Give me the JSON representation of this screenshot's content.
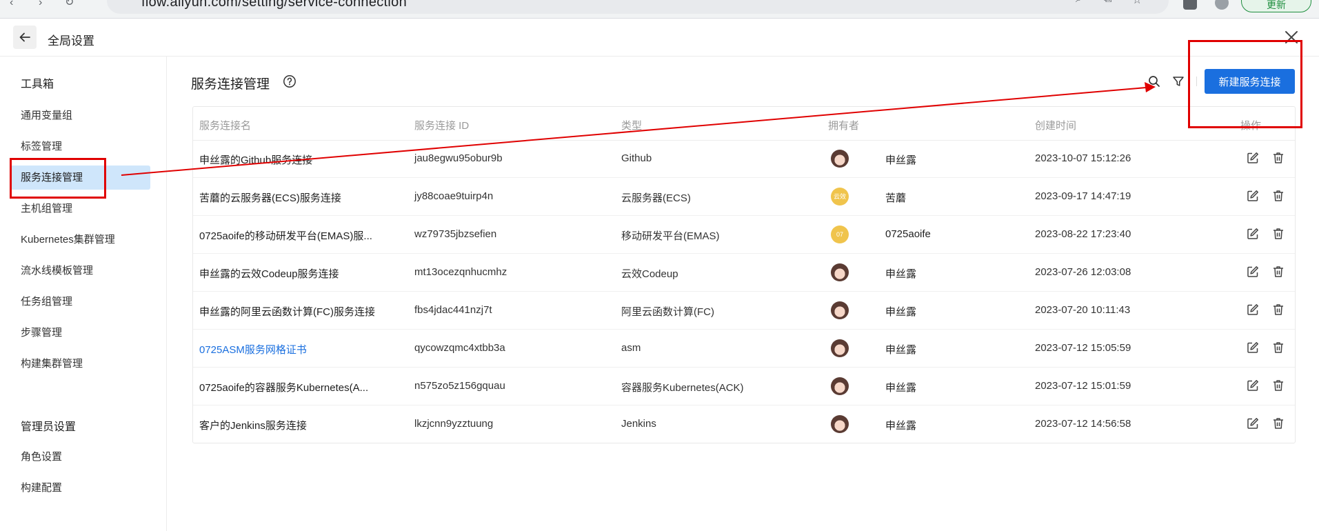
{
  "browser": {
    "url": "flow.aliyun.com/setting/service-connection",
    "update_label": "更新"
  },
  "header": {
    "title": "全局设置"
  },
  "sidebar": {
    "toolbox_title": "工具箱",
    "toolbox_items": [
      {
        "label": "通用变量组"
      },
      {
        "label": "标签管理"
      },
      {
        "label": "服务连接管理",
        "active": true
      },
      {
        "label": "主机组管理"
      },
      {
        "label": "Kubernetes集群管理"
      },
      {
        "label": "流水线模板管理"
      },
      {
        "label": "任务组管理"
      },
      {
        "label": "步骤管理"
      },
      {
        "label": "构建集群管理"
      }
    ],
    "admin_title": "管理员设置",
    "admin_items": [
      {
        "label": "角色设置"
      },
      {
        "label": "构建配置"
      }
    ]
  },
  "main": {
    "title": "服务连接管理",
    "new_button": "新建服务连接",
    "columns": [
      "服务连接名",
      "服务连接 ID",
      "类型",
      "拥有者",
      "创建时间",
      "操作"
    ],
    "rows": [
      {
        "name": "申丝露的Github服务连接",
        "id": "jau8egwu95obur9b",
        "type": "Github",
        "owner": "申丝露",
        "avatar": "photo",
        "created": "2023-10-07 15:12:26"
      },
      {
        "name": "苦蘑的云服务器(ECS)服务连接",
        "id": "jy88coae9tuirp4n",
        "type": "云服务器(ECS)",
        "owner": "苦蘑",
        "avatar": "gold",
        "avatar_text": "云效",
        "created": "2023-09-17 14:47:19"
      },
      {
        "name": "0725aoife的移动研发平台(EMAS)服...",
        "id": "wz79735jbzsefien",
        "type": "移动研发平台(EMAS)",
        "owner": "0725aoife",
        "avatar": "gold",
        "avatar_text": "07",
        "created": "2023-08-22 17:23:40"
      },
      {
        "name": "申丝露的云效Codeup服务连接",
        "id": "mt13ocezqnhucmhz",
        "type": "云效Codeup",
        "owner": "申丝露",
        "avatar": "photo",
        "created": "2023-07-26 12:03:08"
      },
      {
        "name": "申丝露的阿里云函数计算(FC)服务连接",
        "id": "fbs4jdac441nzj7t",
        "type": "阿里云函数计算(FC)",
        "owner": "申丝露",
        "avatar": "photo",
        "created": "2023-07-20 10:11:43"
      },
      {
        "name": "0725ASM服务网格证书",
        "id": "qycowzqmc4xtbb3a",
        "type": "asm",
        "owner": "申丝露",
        "avatar": "photo",
        "link": true,
        "created": "2023-07-12 15:05:59"
      },
      {
        "name": "0725aoife的容器服务Kubernetes(A...",
        "id": "n575zo5z156gquau",
        "type": "容器服务Kubernetes(ACK)",
        "owner": "申丝露",
        "avatar": "photo",
        "created": "2023-07-12 15:01:59"
      },
      {
        "name": "客户的Jenkins服务连接",
        "id": "lkzjcnn9yzztuung",
        "type": "Jenkins",
        "owner": "申丝露",
        "avatar": "photo",
        "created": "2023-07-12 14:56:58"
      }
    ]
  },
  "colors": {
    "primary": "#1a6fdf",
    "active_bg": "#cfe6fb",
    "annotation": "#e00000"
  }
}
